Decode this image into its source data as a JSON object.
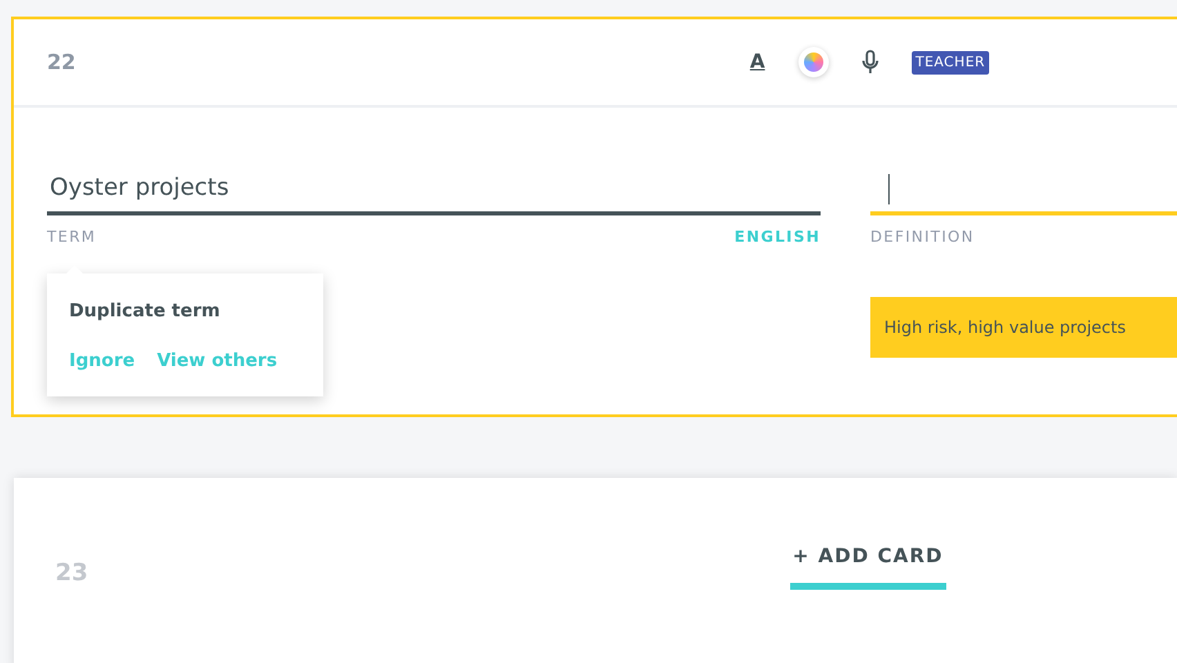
{
  "card": {
    "number": "22",
    "active": true,
    "toolbar": {
      "format_button": "A",
      "badge": "TEACHER"
    },
    "term": {
      "value": "Oyster projects",
      "label": "TERM",
      "language": "ENGLISH",
      "focused": false
    },
    "definition": {
      "label": "DEFINITION",
      "focused": true
    },
    "popover": {
      "title": "Duplicate term",
      "actions": [
        "Ignore",
        "View others"
      ]
    },
    "suggestions": [
      "High risk, high value projects"
    ]
  },
  "next_card": {
    "number": "23",
    "add_button": "+ ADD CARD"
  }
}
